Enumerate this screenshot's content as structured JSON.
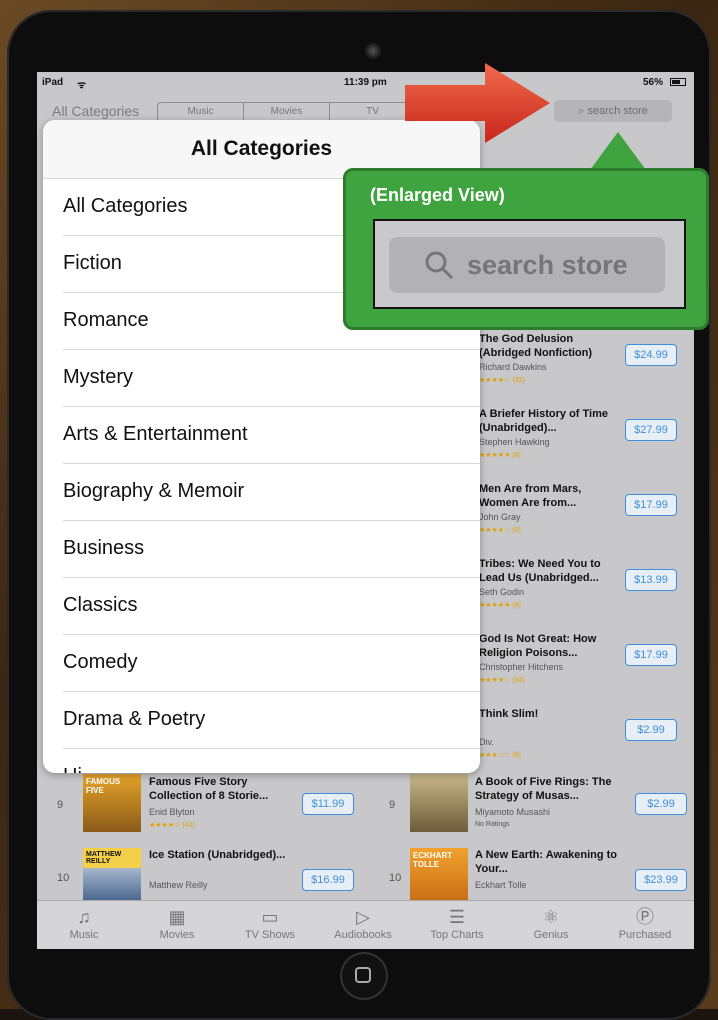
{
  "status": {
    "device": "iPad",
    "time": "11:39 pm",
    "battery": "56%"
  },
  "nav": {
    "label": "All Categories",
    "segments": [
      "Music",
      "Movies",
      "TV"
    ],
    "search_placeholder": "search store"
  },
  "popover": {
    "title": "All Categories",
    "items": [
      "All Categories",
      "Fiction",
      "Romance",
      "Mystery",
      "Arts & Entertainment",
      "Biography & Memoir",
      "Business",
      "Classics",
      "Comedy",
      "Drama & Poetry",
      "Hi..."
    ]
  },
  "callout": {
    "title": "(Enlarged View)",
    "search_text": "search store"
  },
  "right_books": [
    {
      "title": "The God Delusion (Abridged Nonfiction)",
      "author": "Richard Dawkins",
      "ratings": "★★★★☆ (32)",
      "price": "$24.99"
    },
    {
      "title": "A Briefer History of Time (Unabridged)...",
      "author": "Stephen Hawking",
      "ratings": "★★★★★ (8)",
      "price": "$27.99"
    },
    {
      "title": "Men Are from Mars, Women Are from...",
      "author": "John Gray",
      "ratings": "★★★★☆ (9)",
      "price": "$17.99"
    },
    {
      "title": "Tribes: We Need You to Lead Us (Unabridged...",
      "author": "Seth Godin",
      "ratings": "★★★★★ (8)",
      "price": "$13.99"
    },
    {
      "title": "God Is Not Great: How Religion Poisons...",
      "author": "Christopher Hitchens",
      "ratings": "★★★★☆ (34)",
      "price": "$17.99"
    },
    {
      "title": "Think Slim!",
      "author": "Div.",
      "ratings": "★★★☆☆ (8)",
      "price": "$2.99"
    }
  ],
  "bottom_rows": [
    {
      "num": "9",
      "title": "Famous Five Story Collection of 8 Storie...",
      "author": "Enid Blyton",
      "ratings": "★★★★☆ (42)",
      "price": "$11.99",
      "cover_text": "FAMOUS FIVE"
    },
    {
      "num": "9",
      "title": "A Book of Five Rings: The Strategy of Musas...",
      "author": "Miyamoto Musashi",
      "ratings": "No Ratings",
      "price": "$2.99",
      "cover_text": ""
    },
    {
      "num": "10",
      "title": "Ice Station (Unabridged)...",
      "author": "Matthew Reilly",
      "ratings": "★★★★☆",
      "price": "$16.99",
      "cover_text": "MATTHEW REILLY"
    },
    {
      "num": "10",
      "title": "A New Earth: Awakening to Your...",
      "author": "Eckhart Tolle",
      "ratings": "★★★★☆",
      "price": "$23.99",
      "cover_text": "ECKHART TOLLE"
    }
  ],
  "tabs": [
    "Music",
    "Movies",
    "TV Shows",
    "Audiobooks",
    "Top Charts",
    "Genius",
    "Purchased"
  ],
  "colors": {
    "accent": "#3d8fdc",
    "callout": "#3fa33f",
    "arrow": "#e53b2c"
  }
}
